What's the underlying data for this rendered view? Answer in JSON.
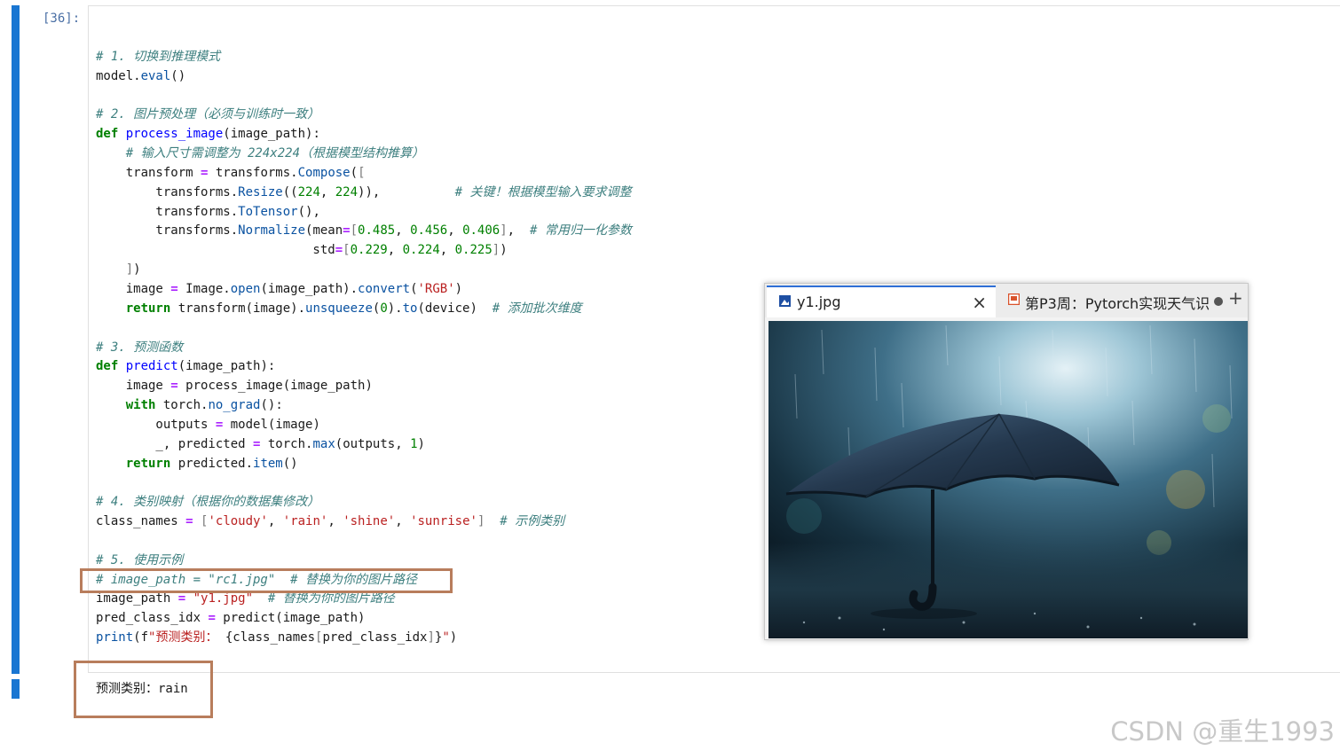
{
  "cell": {
    "prompt": "[36]:",
    "lines": [
      [],
      [
        {
          "c": "cm",
          "t": "# 1. 切换到推理模式"
        }
      ],
      [
        {
          "c": "",
          "t": "model."
        },
        {
          "c": "at",
          "t": "eval"
        },
        {
          "c": "",
          "t": "()"
        }
      ],
      [],
      [
        {
          "c": "cm",
          "t": "# 2. 图片预处理（必须与训练时一致）"
        }
      ],
      [
        {
          "c": "kw",
          "t": "def "
        },
        {
          "c": "fn",
          "t": "process_image"
        },
        {
          "c": "",
          "t": "(image_path):"
        }
      ],
      [
        {
          "c": "",
          "t": "    "
        },
        {
          "c": "cm",
          "t": "# 输入尺寸需调整为 224x224（根据模型结构推算）"
        }
      ],
      [
        {
          "c": "",
          "t": "    transform "
        },
        {
          "c": "op",
          "t": "="
        },
        {
          "c": "",
          "t": " transforms."
        },
        {
          "c": "at",
          "t": "Compose"
        },
        {
          "c": "",
          "t": "("
        },
        {
          "c": "br",
          "t": "["
        }
      ],
      [
        {
          "c": "",
          "t": "        transforms."
        },
        {
          "c": "at",
          "t": "Resize"
        },
        {
          "c": "",
          "t": "(("
        },
        {
          "c": "nm",
          "t": "224"
        },
        {
          "c": "",
          "t": ", "
        },
        {
          "c": "nm",
          "t": "224"
        },
        {
          "c": "",
          "t": ")),          "
        },
        {
          "c": "cm",
          "t": "# 关键！根据模型输入要求调整"
        }
      ],
      [
        {
          "c": "",
          "t": "        transforms."
        },
        {
          "c": "at",
          "t": "ToTensor"
        },
        {
          "c": "",
          "t": "(),"
        }
      ],
      [
        {
          "c": "",
          "t": "        transforms."
        },
        {
          "c": "at",
          "t": "Normalize"
        },
        {
          "c": "",
          "t": "(mean"
        },
        {
          "c": "op",
          "t": "="
        },
        {
          "c": "br",
          "t": "["
        },
        {
          "c": "nm",
          "t": "0.485"
        },
        {
          "c": "",
          "t": ", "
        },
        {
          "c": "nm",
          "t": "0.456"
        },
        {
          "c": "",
          "t": ", "
        },
        {
          "c": "nm",
          "t": "0.406"
        },
        {
          "c": "br",
          "t": "]"
        },
        {
          "c": "",
          "t": ",  "
        },
        {
          "c": "cm",
          "t": "# 常用归一化参数"
        }
      ],
      [
        {
          "c": "",
          "t": "                             std"
        },
        {
          "c": "op",
          "t": "="
        },
        {
          "c": "br",
          "t": "["
        },
        {
          "c": "nm",
          "t": "0.229"
        },
        {
          "c": "",
          "t": ", "
        },
        {
          "c": "nm",
          "t": "0.224"
        },
        {
          "c": "",
          "t": ", "
        },
        {
          "c": "nm",
          "t": "0.225"
        },
        {
          "c": "br",
          "t": "]"
        },
        {
          "c": "",
          "t": ")"
        }
      ],
      [
        {
          "c": "",
          "t": "    "
        },
        {
          "c": "br",
          "t": "]"
        },
        {
          "c": "",
          "t": ")"
        }
      ],
      [
        {
          "c": "",
          "t": "    image "
        },
        {
          "c": "op",
          "t": "="
        },
        {
          "c": "",
          "t": " Image."
        },
        {
          "c": "at",
          "t": "open"
        },
        {
          "c": "",
          "t": "(image_path)."
        },
        {
          "c": "at",
          "t": "convert"
        },
        {
          "c": "",
          "t": "("
        },
        {
          "c": "st",
          "t": "'RGB'"
        },
        {
          "c": "",
          "t": ")"
        }
      ],
      [
        {
          "c": "",
          "t": "    "
        },
        {
          "c": "kw",
          "t": "return"
        },
        {
          "c": "",
          "t": " transform(image)."
        },
        {
          "c": "at",
          "t": "unsqueeze"
        },
        {
          "c": "",
          "t": "("
        },
        {
          "c": "nm",
          "t": "0"
        },
        {
          "c": "",
          "t": ")."
        },
        {
          "c": "at",
          "t": "to"
        },
        {
          "c": "",
          "t": "(device)  "
        },
        {
          "c": "cm",
          "t": "# 添加批次维度"
        }
      ],
      [],
      [
        {
          "c": "cm",
          "t": "# 3. 预测函数"
        }
      ],
      [
        {
          "c": "kw",
          "t": "def "
        },
        {
          "c": "fn",
          "t": "predict"
        },
        {
          "c": "",
          "t": "(image_path):"
        }
      ],
      [
        {
          "c": "",
          "t": "    image "
        },
        {
          "c": "op",
          "t": "="
        },
        {
          "c": "",
          "t": " process_image(image_path)"
        }
      ],
      [
        {
          "c": "",
          "t": "    "
        },
        {
          "c": "kw",
          "t": "with"
        },
        {
          "c": "",
          "t": " torch."
        },
        {
          "c": "at",
          "t": "no_grad"
        },
        {
          "c": "",
          "t": "():"
        }
      ],
      [
        {
          "c": "",
          "t": "        outputs "
        },
        {
          "c": "op",
          "t": "="
        },
        {
          "c": "",
          "t": " model(image)"
        }
      ],
      [
        {
          "c": "",
          "t": "        _, predicted "
        },
        {
          "c": "op",
          "t": "="
        },
        {
          "c": "",
          "t": " torch."
        },
        {
          "c": "at",
          "t": "max"
        },
        {
          "c": "",
          "t": "(outputs, "
        },
        {
          "c": "nm",
          "t": "1"
        },
        {
          "c": "",
          "t": ")"
        }
      ],
      [
        {
          "c": "",
          "t": "    "
        },
        {
          "c": "kw",
          "t": "return"
        },
        {
          "c": "",
          "t": " predicted."
        },
        {
          "c": "at",
          "t": "item"
        },
        {
          "c": "",
          "t": "()"
        }
      ],
      [],
      [
        {
          "c": "cm",
          "t": "# 4. 类别映射（根据你的数据集修改）"
        }
      ],
      [
        {
          "c": "",
          "t": "class_names "
        },
        {
          "c": "op",
          "t": "="
        },
        {
          "c": "",
          "t": " "
        },
        {
          "c": "br",
          "t": "["
        },
        {
          "c": "st",
          "t": "'cloudy'"
        },
        {
          "c": "",
          "t": ", "
        },
        {
          "c": "st",
          "t": "'rain'"
        },
        {
          "c": "",
          "t": ", "
        },
        {
          "c": "st",
          "t": "'shine'"
        },
        {
          "c": "",
          "t": ", "
        },
        {
          "c": "st",
          "t": "'sunrise'"
        },
        {
          "c": "br",
          "t": "]"
        },
        {
          "c": "",
          "t": "  "
        },
        {
          "c": "cm",
          "t": "# 示例类别"
        }
      ],
      [],
      [
        {
          "c": "cm",
          "t": "# 5. 使用示例"
        }
      ],
      [
        {
          "c": "cm",
          "t": "# image_path = \"rc1.jpg\"  # 替换为你的图片路径"
        }
      ],
      [
        {
          "c": "",
          "t": "image_path "
        },
        {
          "c": "op",
          "t": "="
        },
        {
          "c": "",
          "t": " "
        },
        {
          "c": "st",
          "t": "\"y1.jpg\""
        },
        {
          "c": "",
          "t": "  "
        },
        {
          "c": "cm",
          "t": "# 替换为你的图片路径"
        }
      ],
      [
        {
          "c": "",
          "t": "pred_class_idx "
        },
        {
          "c": "op",
          "t": "="
        },
        {
          "c": "",
          "t": " predict(image_path)"
        }
      ],
      [
        {
          "c": "at",
          "t": "print"
        },
        {
          "c": "",
          "t": "(f"
        },
        {
          "c": "st",
          "t": "\"预测类别："
        },
        {
          "c": "",
          "t": " {class_names"
        },
        {
          "c": "br",
          "t": "["
        },
        {
          "c": "",
          "t": "pred_class_idx"
        },
        {
          "c": "br",
          "t": "]"
        },
        {
          "c": "",
          "t": "}"
        },
        {
          "c": "st",
          "t": "\""
        },
        {
          "c": "",
          "t": ")"
        }
      ]
    ]
  },
  "output": {
    "text": "预测类别：rain"
  },
  "viewer": {
    "tab1_label": "y1.jpg",
    "tab1_icon": "image-icon",
    "tab2_label": "第P3周：Pytorch实现天气识",
    "tab2_icon": "document-icon",
    "close_symbol": "×",
    "new_tab_symbol": "+",
    "photo_description_icon": "umbrella-in-rain-photo"
  },
  "watermark": "CSDN @重生1993",
  "colors": {
    "cell_bar": "#1976d2",
    "highlight_border": "#b87d5c",
    "active_tab_accent": "#2f6fd6"
  }
}
